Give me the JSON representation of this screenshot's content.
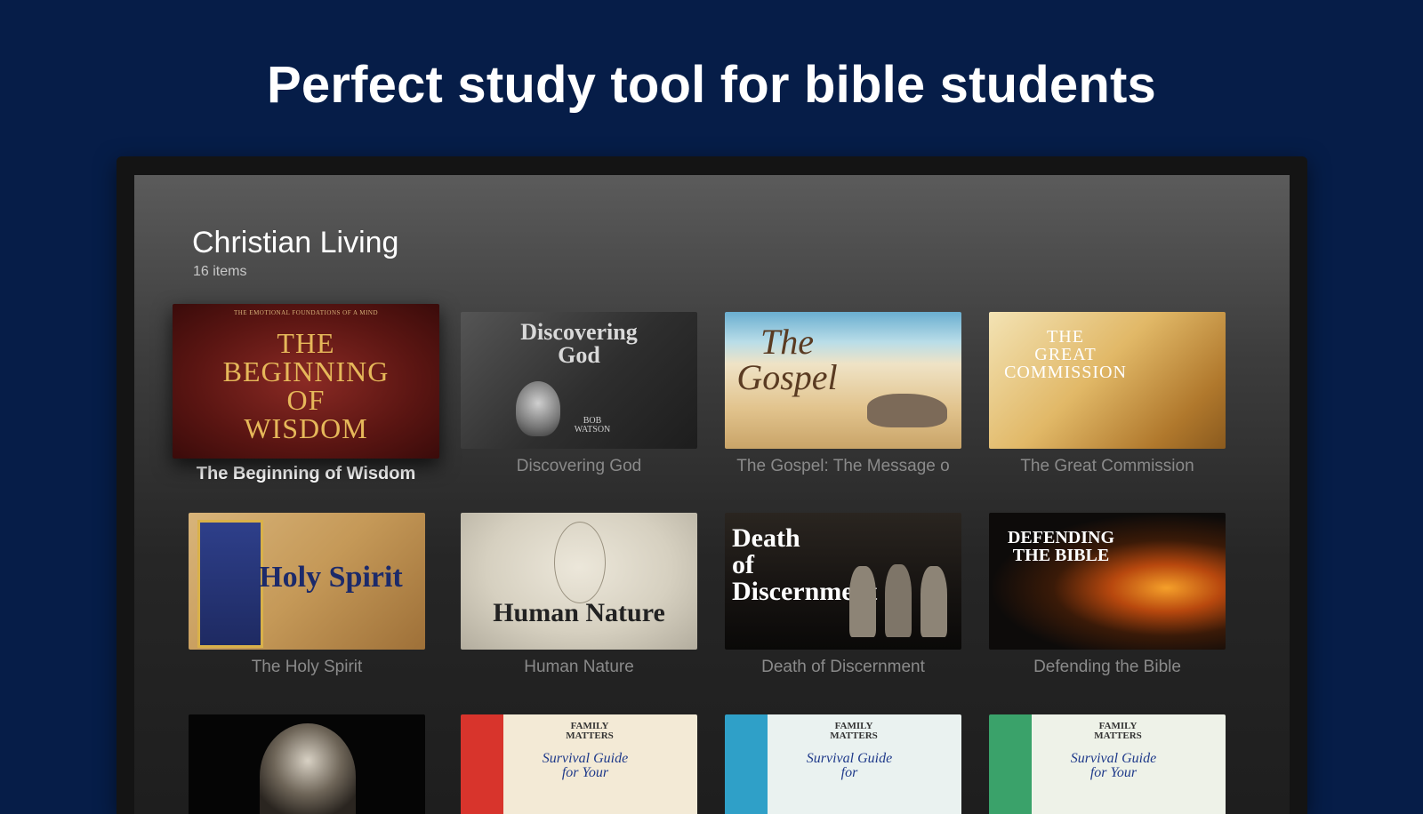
{
  "headline": "Perfect study tool for bible students",
  "category": {
    "title": "Christian Living",
    "count": "16 items"
  },
  "cards": [
    {
      "label": "The Beginning of Wisdom",
      "art_title": "THE\nBEGINNING\nOF\nWISDOM",
      "art_sub": "THE EMOTIONAL FOUNDATIONS OF A MIND"
    },
    {
      "label": "Discovering God",
      "art_title": "Discovering\nGod",
      "art_sub": "BOB\nWATSON"
    },
    {
      "label": "The Gospel: The Message o",
      "art_title": "The\nGospel",
      "art_sub": ""
    },
    {
      "label": "The Great Commission",
      "art_title": "THE\nGREAT\nCOMMISSION",
      "art_sub": ""
    },
    {
      "label": "The Holy Spirit",
      "art_title": "Holy Spirit",
      "art_sub": ""
    },
    {
      "label": "Human Nature",
      "art_title": "Human Nature",
      "art_sub": ""
    },
    {
      "label": "Death of Discernment",
      "art_title": "Death\nof Discernment",
      "art_sub": ""
    },
    {
      "label": "Defending the Bible",
      "art_title": "DEFENDING\nTHE BIBLE",
      "art_sub": ""
    },
    {
      "label": "",
      "art_title": "",
      "art_sub": ""
    },
    {
      "label": "",
      "art_title": "FAMILY\nMATTERS",
      "art_sub": "Survival Guide\nfor Your"
    },
    {
      "label": "",
      "art_title": "FAMILY\nMATTERS",
      "art_sub": "Survival Guide\nfor"
    },
    {
      "label": "",
      "art_title": "FAMILY\nMATTERS",
      "art_sub": "Survival Guide\nfor Your"
    }
  ]
}
